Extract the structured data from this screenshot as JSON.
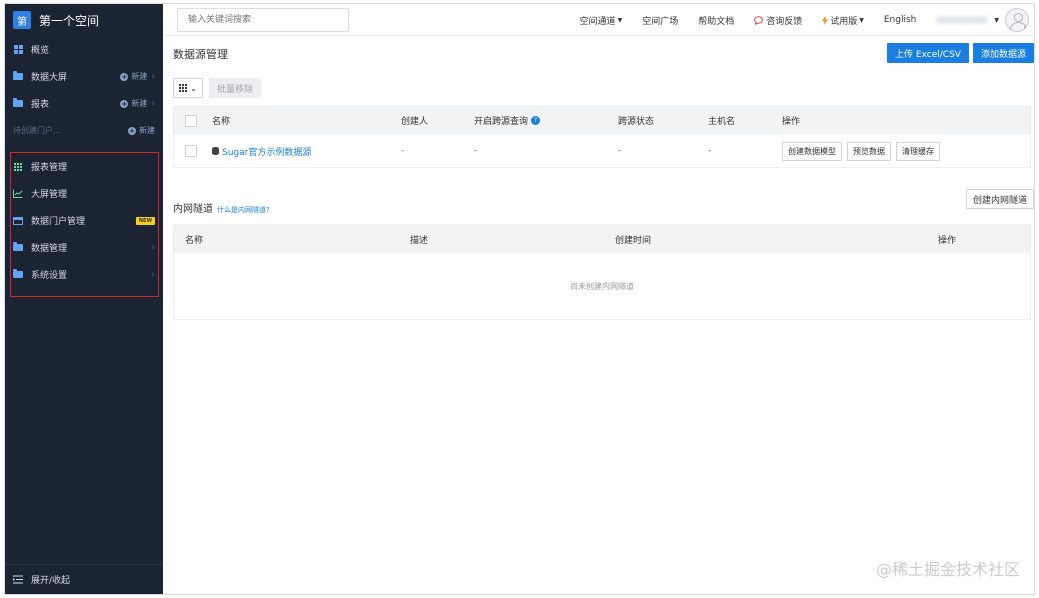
{
  "app": {
    "brand_badge": "第",
    "workspace_name": "第一个空间"
  },
  "sidebar": {
    "items": [
      {
        "label": "概览",
        "icon": "grid-icon"
      },
      {
        "label": "数据大屏",
        "icon": "folder-icon",
        "action": "新建"
      },
      {
        "label": "报表",
        "icon": "folder-icon",
        "action": "新建"
      }
    ],
    "pending": {
      "label": "待创建门户...",
      "action": "新建"
    },
    "group": [
      {
        "label": "报表管理",
        "icon": "table-icon"
      },
      {
        "label": "大屏管理",
        "icon": "chart-icon"
      },
      {
        "label": "数据门户管理",
        "icon": "window-icon",
        "badge": "NEW"
      },
      {
        "label": "数据管理",
        "icon": "folder-icon"
      },
      {
        "label": "系统设置",
        "icon": "folder-icon"
      }
    ],
    "collapse_label": "展开/收起"
  },
  "topbar": {
    "search_placeholder": "输入关键词搜索",
    "links": {
      "space_channel": "空间通道",
      "space_square": "空间广场",
      "help_docs": "帮助文档",
      "feedback": "咨询反馈",
      "trial": "试用版",
      "language": "English"
    }
  },
  "main": {
    "title": "数据源管理",
    "upload_button": "上传 Excel/CSV",
    "add_button": "添加数据源",
    "batch_remove": "批量移除",
    "datasource_table": {
      "columns": [
        "名称",
        "创建人",
        "开启跨源查询",
        "跨源状态",
        "主机名",
        "操作"
      ],
      "rows": [
        {
          "name": "Sugar官方示例数据源",
          "creator": "-",
          "cross_query": "-",
          "cross_status": "-",
          "host": "-",
          "actions": [
            "创建数据模型",
            "预览数据",
            "清理缓存"
          ]
        }
      ]
    },
    "tunnel": {
      "title": "内网隧道",
      "help_link": "什么是内网隧道?",
      "create_button": "创建内网隧道",
      "columns": [
        "名称",
        "描述",
        "创建时间",
        "操作"
      ],
      "empty_text": "尚未创建内网隧道"
    }
  },
  "watermark": "@稀土掘金技术社区",
  "colors": {
    "sidebar_bg": "#1b2433",
    "primary": "#1a7fe0",
    "highlight_border": "#e0202a",
    "new_badge": "#f5d01a"
  }
}
